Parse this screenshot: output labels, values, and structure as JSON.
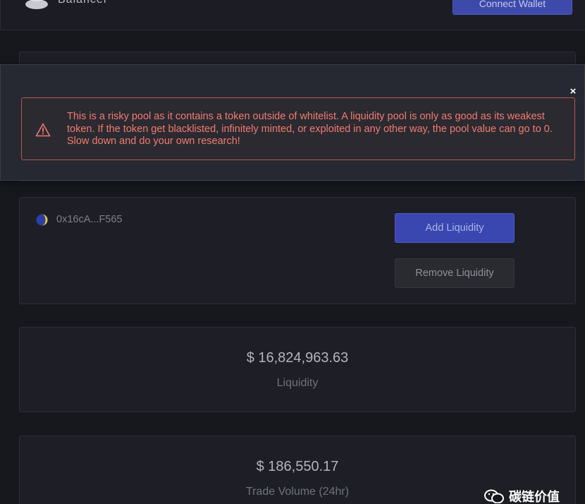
{
  "header": {
    "app_name": "Balancer",
    "connect_button": "Connect Wallet"
  },
  "warning": {
    "close_label": "×",
    "message": "This is a risky pool as it contains a token outside of whitelist. A liquidity pool is only as good as its weakest token. If the token get blacklisted, infinitely minted, or exploited in any other way, the pool value can go to 0. Slow down and do your own research!",
    "icon": "warning-triangle-icon"
  },
  "pool": {
    "address": "0x16cA...F565",
    "token_icon": "token-icon",
    "add_liquidity_label": "Add Liquidity",
    "remove_liquidity_label": "Remove Liquidity"
  },
  "stats": {
    "liquidity_value": "$ 16,824,963.63",
    "liquidity_label": "Liquidity",
    "volume_value": "$ 186,550.17",
    "volume_label": "Trade Volume (24hr)"
  },
  "watermark": {
    "text": "碳链价值",
    "icon": "wechat-icon"
  },
  "colors": {
    "background": "#17181e",
    "card": "#1e1f26",
    "accent_button": "#3a47b0",
    "warning_text": "#ee7b70",
    "warning_border": "#b85550"
  }
}
